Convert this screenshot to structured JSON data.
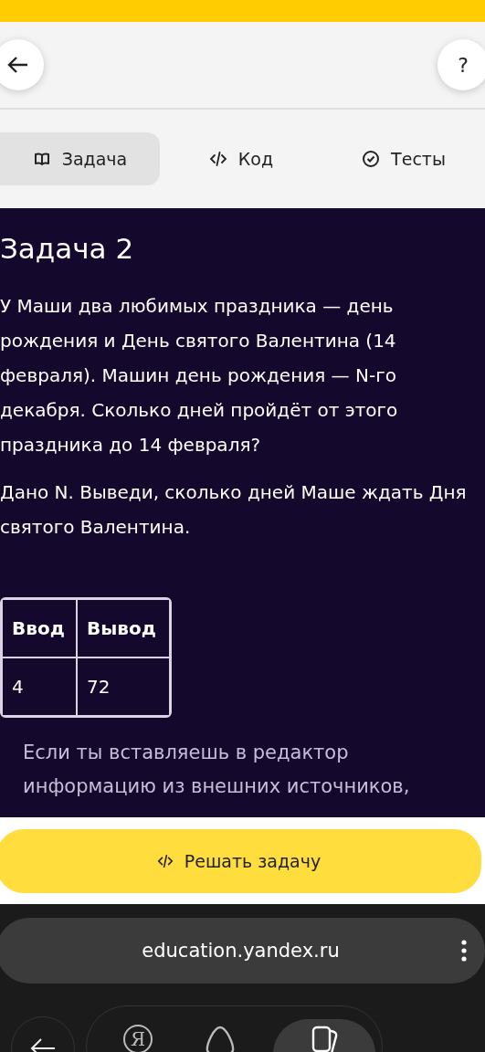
{
  "header": {
    "help": "?"
  },
  "tabs": [
    {
      "label": "Задача",
      "selected": true
    },
    {
      "label": "Код",
      "selected": false
    },
    {
      "label": "Тесты",
      "selected": false
    }
  ],
  "task": {
    "title": "Задача 2",
    "paragraphs": [
      "У Маши два любимых праздника — день рождения и День святого Валентина (14 февраля). Машин день рождения — N-го декабря. Сколько дней пройдёт от этого праздника до 14 февраля?",
      "Дано N. Выведи, сколько дней Маше ждать Дня святого Валентина."
    ],
    "table": {
      "columns": [
        "Ввод",
        "Вывод"
      ],
      "rows": [
        [
          "4",
          "72"
        ]
      ]
    },
    "note": "Если ты вставляешь в редактор информацию из внешних источников,"
  },
  "solve_button": {
    "label": "Решать задачу"
  },
  "browser": {
    "url": "education.yandex.ru",
    "logo": "Я"
  }
}
